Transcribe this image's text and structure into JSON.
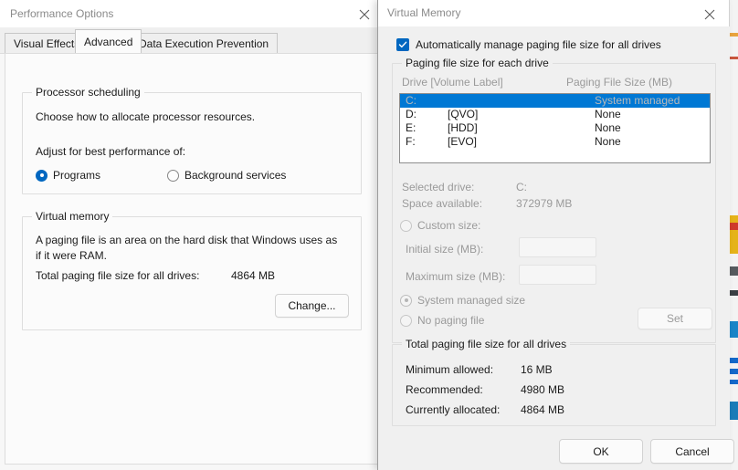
{
  "performance_options": {
    "title": "Performance Options",
    "close_icon": "close-icon",
    "tabs": [
      {
        "label": "Visual Effects",
        "selected": false
      },
      {
        "label": "Advanced",
        "selected": true
      },
      {
        "label": "Data Execution Prevention",
        "selected": false
      }
    ],
    "processor_scheduling": {
      "group_label": "Processor scheduling",
      "description": "Choose how to allocate processor resources.",
      "adjust_label": "Adjust for best performance of:",
      "options": [
        {
          "label": "Programs",
          "selected": true
        },
        {
          "label": "Background services",
          "selected": false
        }
      ]
    },
    "virtual_memory": {
      "group_label": "Virtual memory",
      "description": "A paging file is an area on the hard disk that Windows uses as if it were RAM.",
      "total_label": "Total paging file size for all drives:",
      "total_value": "4864 MB",
      "change_button": "Change..."
    }
  },
  "virtual_memory_dialog": {
    "title": "Virtual Memory",
    "close_icon": "close-icon",
    "auto_manage": {
      "label": "Automatically manage paging file size for all drives",
      "checked": true
    },
    "paging_group": {
      "group_label": "Paging file size for each drive",
      "columns": [
        "Drive  [Volume Label]",
        "Paging File Size (MB)"
      ],
      "rows": [
        {
          "drive": "C:",
          "volume": "",
          "size": "System managed",
          "selected": true
        },
        {
          "drive": "D:",
          "volume": "[QVO]",
          "size": "None",
          "selected": false
        },
        {
          "drive": "E:",
          "volume": "[HDD]",
          "size": "None",
          "selected": false
        },
        {
          "drive": "F:",
          "volume": "[EVO]",
          "size": "None",
          "selected": false
        }
      ]
    },
    "drive_settings": {
      "selected_drive_label": "Selected drive:",
      "selected_drive_value": "C:",
      "space_available_label": "Space available:",
      "space_available_value": "372979 MB",
      "custom_size": {
        "label": "Custom size:",
        "selected": false
      },
      "initial_size_label": "Initial size (MB):",
      "initial_size_value": "",
      "maximum_size_label": "Maximum size (MB):",
      "maximum_size_value": "",
      "system_managed": {
        "label": "System managed size",
        "selected": true
      },
      "no_paging_file": {
        "label": "No paging file",
        "selected": false
      },
      "set_button": "Set",
      "disabled": true
    },
    "totals_group": {
      "group_label": "Total paging file size for all drives",
      "rows": [
        {
          "label": "Minimum allowed:",
          "value": "16 MB"
        },
        {
          "label": "Recommended:",
          "value": "4980 MB"
        },
        {
          "label": "Currently allocated:",
          "value": "4864 MB"
        }
      ]
    },
    "footer": {
      "ok_label": "OK",
      "cancel_label": "Cancel"
    }
  },
  "colors": {
    "accent": "#0067c0",
    "selection": "#0078d4",
    "window_bg": "#f0f0f0",
    "tabpage_bg": "#fbfbfb"
  }
}
